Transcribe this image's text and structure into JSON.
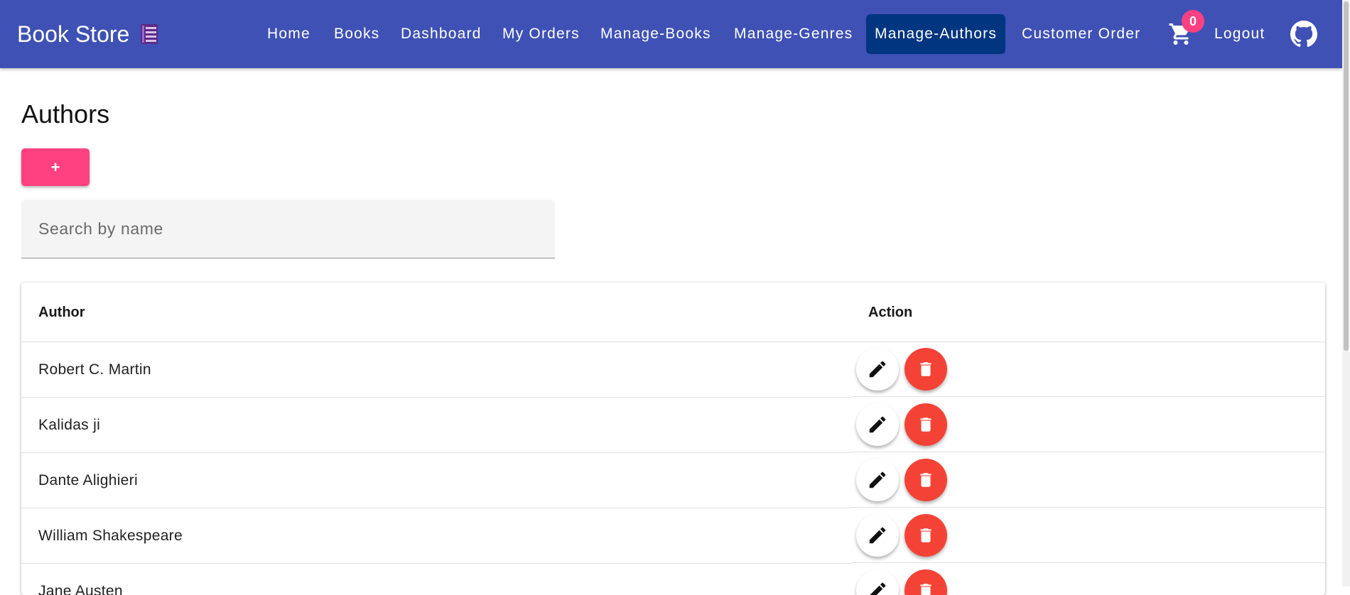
{
  "header": {
    "brand": "Book Store",
    "brand_icon": "book-icon",
    "nav": [
      {
        "label": "Home"
      },
      {
        "label": "Books"
      },
      {
        "label": "Dashboard"
      },
      {
        "label": "My Orders"
      },
      {
        "label": "Manage-Books"
      },
      {
        "label": "Manage-Genres"
      },
      {
        "label": "Manage-Authors",
        "active": true
      },
      {
        "label": "Customer Order"
      }
    ],
    "cart_icon": "cart-icon",
    "cart_count": "0",
    "logout_label": "Logout",
    "github_icon": "github-icon"
  },
  "colors": {
    "appbar": "#3f51b5",
    "active_nav": "#003580",
    "accent": "#ff4081",
    "delete": "#f44336"
  },
  "main": {
    "title": "Authors",
    "add_button_label": "+",
    "search_placeholder": "Search by name",
    "search_value": ""
  },
  "table": {
    "columns": [
      "Author",
      "Action"
    ],
    "rows": [
      {
        "author": "Robert C. Martin"
      },
      {
        "author": "Kalidas ji"
      },
      {
        "author": "Dante Alighieri"
      },
      {
        "author": "William Shakespeare"
      },
      {
        "author": "Jane Austen"
      }
    ],
    "edit_icon": "pencil-icon",
    "delete_icon": "trash-icon"
  }
}
